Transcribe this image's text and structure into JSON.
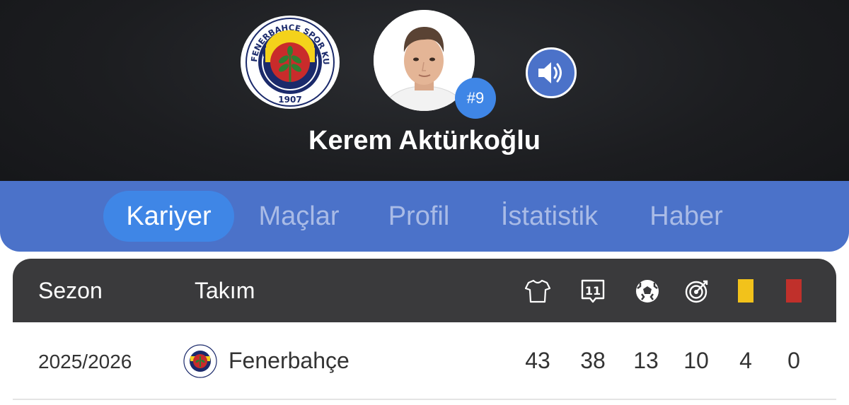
{
  "header": {
    "player_name": "Kerem Aktürkoğlu",
    "shirt_number": "#9",
    "team_logo": {
      "ring_text": "FENERBAHÇE SPOR KULÜBÜ",
      "year": "1907",
      "icon": "fenerbahce-crest-icon"
    },
    "avatar_icon": "player-photo",
    "sound_icon": "speaker-icon"
  },
  "tabs": [
    {
      "label": "Kariyer",
      "active": true
    },
    {
      "label": "Maçlar",
      "active": false
    },
    {
      "label": "Profil",
      "active": false
    },
    {
      "label": "İstatistik",
      "active": false
    },
    {
      "label": "Haber",
      "active": false
    }
  ],
  "table": {
    "columns": {
      "season": "Sezon",
      "team": "Takım",
      "stat_icons": [
        "shirt-icon",
        "lineup-icon",
        "ball-icon",
        "target-icon",
        "yellow-card-icon",
        "red-card-icon"
      ]
    },
    "rows": [
      {
        "season": "2025/2026",
        "team": "Fenerbahçe",
        "stats": [
          "43",
          "38",
          "13",
          "10",
          "4",
          "0"
        ]
      }
    ]
  },
  "colors": {
    "header_bg": "#1c1d20",
    "tabs_bg": "#4b72c9",
    "tab_active": "#3f86e6",
    "tab_inactive_text": "#a9bbe6",
    "table_head_bg": "#3a3a3c",
    "yellow_card": "#f2c21b",
    "red_card": "#c0302b"
  }
}
